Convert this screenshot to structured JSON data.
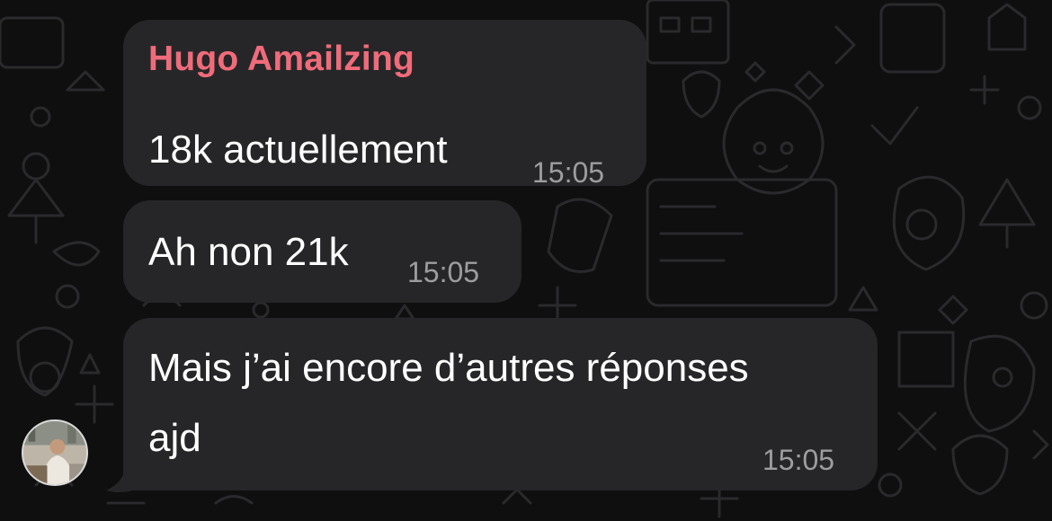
{
  "messages": [
    {
      "sender": "Hugo Amailzing",
      "lines": [
        "18k actuellement"
      ],
      "time": "15:05"
    },
    {
      "lines": [
        "Ah non 21k"
      ],
      "time": "15:05"
    },
    {
      "lines": [
        "Mais j’ai encore d’autres réponses",
        "ajd"
      ],
      "time": "15:05"
    }
  ],
  "colors": {
    "background": "#0f0f10",
    "bubble": "#262628",
    "sender_name": "#f06b7a",
    "timestamp": "#9d9da1",
    "text": "#ffffff"
  },
  "icons": [
    "avatar-photo"
  ]
}
